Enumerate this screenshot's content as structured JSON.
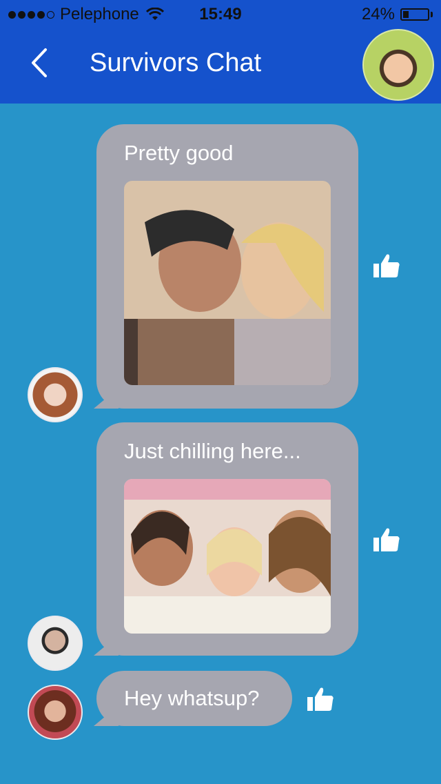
{
  "status_bar": {
    "carrier": "Pelephone",
    "time": "15:49",
    "battery": "24%",
    "battery_level": 0.24,
    "signal_filled": 4
  },
  "header": {
    "title": "Survivors Chat",
    "back_icon": "chevron-left-icon",
    "avatar_icon": "user-avatar"
  },
  "messages": [
    {
      "text": "Pretty good",
      "has_photo": true,
      "like_icon": "thumbs-up-icon"
    },
    {
      "text": "Just chilling here...",
      "has_photo": true,
      "like_icon": "thumbs-up-icon"
    },
    {
      "text": "Hey whatsup?",
      "has_photo": false,
      "like_icon": "thumbs-up-icon"
    }
  ],
  "colors": {
    "header": "#1552cc",
    "background": "#2794c9",
    "bubble": "#a6a6b0"
  }
}
